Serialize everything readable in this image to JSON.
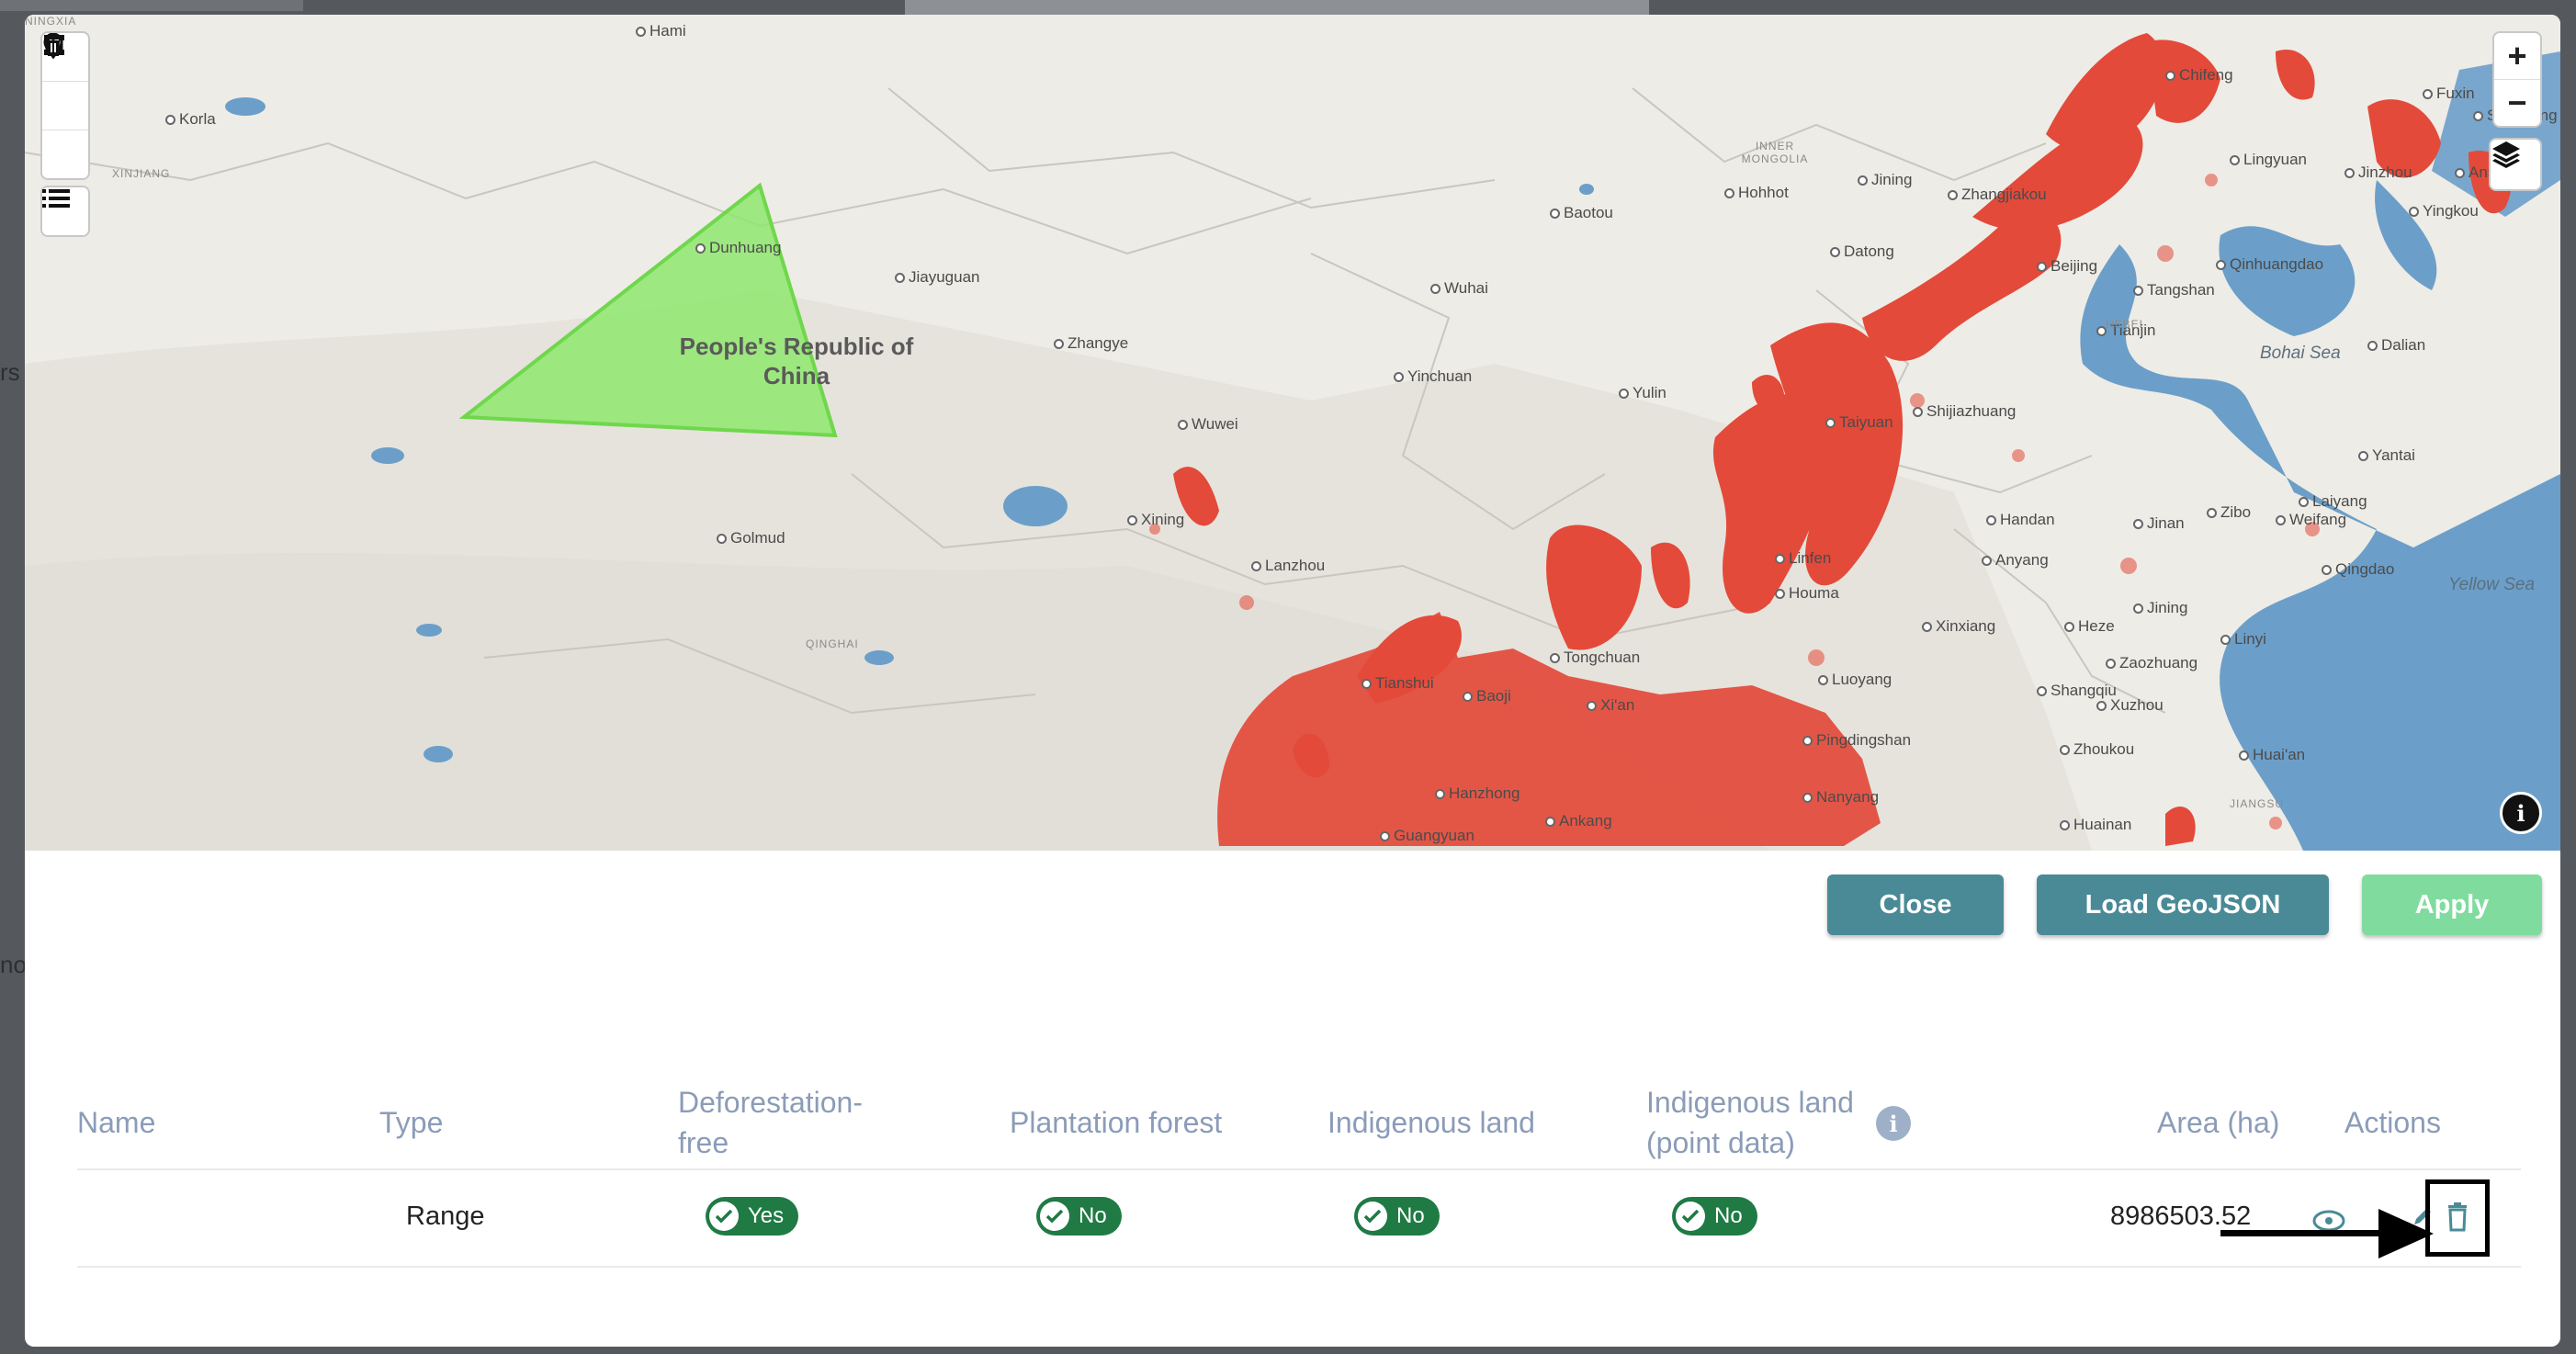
{
  "colors": {
    "primary_button": "#4a8a97",
    "apply_button": "#7fdc9e",
    "badge": "#1f7a43",
    "polygon_fill": "#8ee86d",
    "header_text": "#8b9cb8",
    "deforestation_overlay": "#e34a3a",
    "water": "#6b9fc9"
  },
  "map": {
    "country_label": "People's Republic of China",
    "cities": [
      "Hami",
      "Korla",
      "Dunhuang",
      "Jiayuguan",
      "Zhangye",
      "Wuwei",
      "Golmud",
      "Xining",
      "Lanzhou",
      "Wuhai",
      "Yinchuan",
      "Yulin",
      "Baotou",
      "Hohhot",
      "Jining",
      "Zhangjiakou",
      "Datong",
      "Chifeng",
      "Lingyuan",
      "Beijing",
      "Qinhuangdao",
      "Tangshan",
      "Tianjin",
      "Fuxin",
      "Shenyang",
      "Anshan",
      "Jinzhou",
      "Yingkou",
      "Dalian",
      "Taiyuan",
      "Shijiazhuang",
      "Handan",
      "Anyang",
      "Linfen",
      "Houma",
      "Xinxiang",
      "Heze",
      "Jining",
      "Zibo",
      "Weifang",
      "Jinan",
      "Qingdao",
      "Yantai",
      "Laiyang",
      "Linyi",
      "Zaozhuang",
      "Xuzhou",
      "Shangqiu",
      "Zhoukou",
      "Huai'an",
      "Huainan",
      "Pingdingshan",
      "Nanyang",
      "Luoyang",
      "Xi'an",
      "Tongchuan",
      "Tianshui",
      "Baoji",
      "Hanzhong",
      "Ankang",
      "Guangyuan"
    ],
    "regions": [
      "XINJIANG",
      "INNER MONGOLIA",
      "QINGHAI",
      "NINGXIA",
      "HEBEI",
      "JIANGSU"
    ],
    "seas": [
      "Bohai Sea",
      "Yellow Sea"
    ],
    "icons": [
      "square-draw-icon",
      "marker-icon",
      "trash-icon",
      "list-icon",
      "plus-icon",
      "minus-icon",
      "layers-icon",
      "info-icon"
    ]
  },
  "buttons": {
    "close": "Close",
    "load": "Load GeoJSON",
    "apply": "Apply"
  },
  "table": {
    "headers": {
      "name": "Name",
      "type": "Type",
      "deforestation_line1": "Deforestation-",
      "deforestation_line2": "free",
      "plantation": "Plantation forest",
      "indigenous": "Indigenous land",
      "indigenous_point_line1": "Indigenous land",
      "indigenous_point_line2": "(point data)",
      "area": "Area (ha)",
      "actions": "Actions"
    },
    "rows": [
      {
        "name": "",
        "type": "Range",
        "deforestation_free": "Yes",
        "plantation_forest": "No",
        "indigenous_land": "No",
        "indigenous_point": "No",
        "area": "8986503.52"
      }
    ]
  },
  "backdrop": {
    "left_text": [
      "rs",
      "no"
    ]
  }
}
